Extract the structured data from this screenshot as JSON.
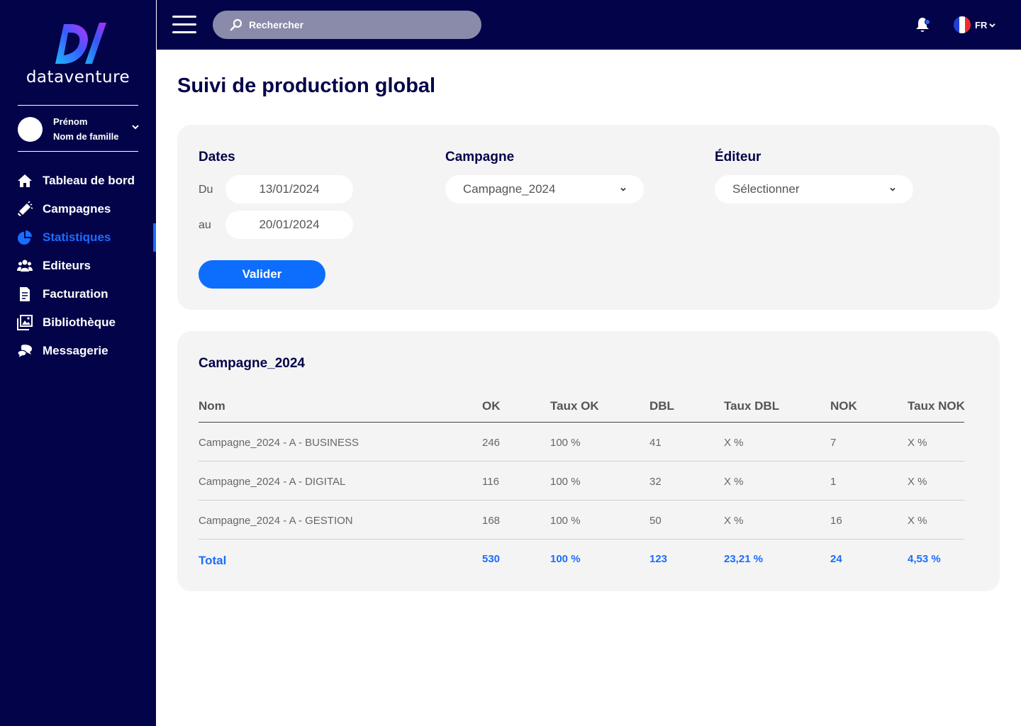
{
  "brand": {
    "name": "dataventure"
  },
  "user": {
    "first_name": "Prénom",
    "last_name": "Nom de famille"
  },
  "nav": {
    "items": [
      {
        "label": "Tableau de bord",
        "icon": "home-icon"
      },
      {
        "label": "Campagnes",
        "icon": "megaphone-icon"
      },
      {
        "label": "Statistiques",
        "icon": "pie-chart-icon",
        "active": true
      },
      {
        "label": "Editeurs",
        "icon": "users-icon"
      },
      {
        "label": "Facturation",
        "icon": "invoice-icon"
      },
      {
        "label": "Bibliothèque",
        "icon": "image-library-icon"
      },
      {
        "label": "Messagerie",
        "icon": "chat-icon"
      }
    ]
  },
  "topbar": {
    "search_placeholder": "Rechercher",
    "language": "FR"
  },
  "page": {
    "title": "Suivi de production global"
  },
  "filters": {
    "dates_heading": "Dates",
    "from_label": "Du",
    "from_value": "13/01/2024",
    "to_label": "au",
    "to_value": "20/01/2024",
    "campaign_heading": "Campagne",
    "campaign_value": "Campagne_2024",
    "editor_heading": "Éditeur",
    "editor_value": "Sélectionner",
    "validate_label": "Valider"
  },
  "results": {
    "title": "Campagne_2024",
    "columns": [
      "Nom",
      "OK",
      "Taux OK",
      "DBL",
      "Taux DBL",
      "NOK",
      "Taux NOK"
    ],
    "rows": [
      [
        "Campagne_2024 - A - BUSINESS",
        "246",
        "100 %",
        "41",
        "X %",
        "7",
        "X %"
      ],
      [
        "Campagne_2024 - A - DIGITAL",
        "116",
        "100 %",
        "32",
        "X %",
        "1",
        "X %"
      ],
      [
        "Campagne_2024 - A - GESTION",
        "168",
        "100 %",
        "50",
        "X %",
        "16",
        "X %"
      ]
    ],
    "total": [
      "Total",
      "530",
      "100 %",
      "123",
      "23,21 %",
      "24",
      "4,53 %"
    ]
  },
  "colors": {
    "sidebar_bg": "#03034a",
    "accent": "#1a6dff",
    "button": "#0d6efd",
    "panel_bg": "#f4f4f4"
  }
}
